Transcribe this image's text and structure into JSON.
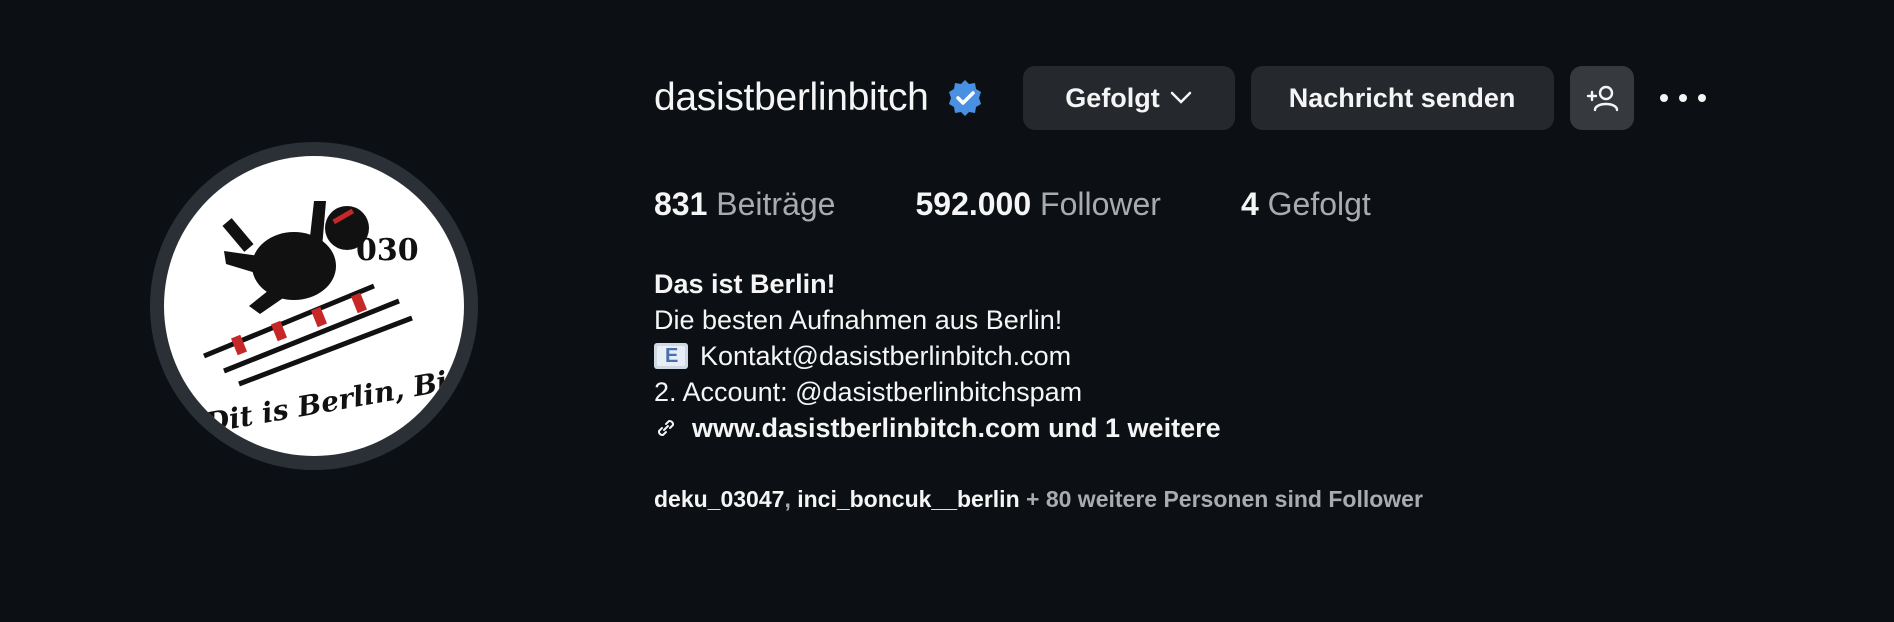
{
  "profile": {
    "username": "dasistberlinbitch",
    "follow_button_label": "Gefolgt",
    "message_button_label": "Nachricht senden",
    "avatar_text": "Dit is Berlin, Bitch!",
    "avatar_number": "030"
  },
  "stats": {
    "posts_count": "831",
    "posts_label": "Beiträge",
    "followers_count": "592.000",
    "followers_label": "Follower",
    "following_count": "4",
    "following_label": "Gefolgt"
  },
  "bio": {
    "name": "Das ist Berlin!",
    "line1": "Die besten Aufnahmen aus Berlin!",
    "line2": "Kontakt@dasistberlinbitch.com",
    "line3": "2. Account: @dasistberlinbitchspam",
    "link": "www.dasistberlinbitch.com und 1 weitere"
  },
  "mutual": {
    "user1": "deku_03047",
    "separator": ", ",
    "user2": "inci_boncuk__berlin",
    "suffix": " + 80 weitere Personen sind Follower"
  },
  "colors": {
    "background": "#0c1014",
    "button": "#25292e",
    "verified": "#4a90e2",
    "muted": "#a8abaf"
  },
  "icons": [
    "verified-badge-icon",
    "chevron-down-icon",
    "add-person-icon",
    "more-options-icon",
    "email-icon",
    "link-icon"
  ]
}
